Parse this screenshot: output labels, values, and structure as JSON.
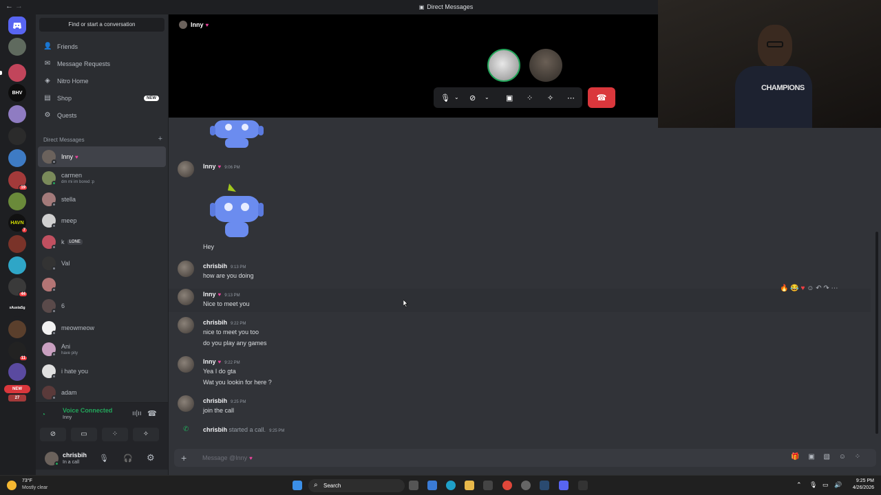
{
  "titlebar": {
    "back": "←",
    "forward": "→",
    "title": "Direct Messages"
  },
  "call": {
    "header_name": "Inny",
    "hangup_icon": "phone-hangup-icon"
  },
  "sidebar": {
    "search_placeholder": "Find or start a conversation",
    "nav": [
      {
        "label": "Friends",
        "icon": "friends-icon"
      },
      {
        "label": "Message Requests",
        "icon": "mail-icon"
      },
      {
        "label": "Nitro Home",
        "icon": "nitro-icon"
      },
      {
        "label": "Shop",
        "icon": "shop-icon",
        "badge": "NEW"
      },
      {
        "label": "Quests",
        "icon": "quests-icon"
      }
    ],
    "dm_header": "Direct Messages",
    "dms": [
      {
        "name": "Inny",
        "sub": ""
      },
      {
        "name": "carmen",
        "sub": "dm mi im bored :p"
      },
      {
        "name": "stella",
        "sub": ""
      },
      {
        "name": "meep",
        "sub": ""
      },
      {
        "name": "k",
        "tag": "LONE",
        "sub": ""
      },
      {
        "name": "Val",
        "sub": ""
      },
      {
        "name": "",
        "sub": ""
      },
      {
        "name": "6",
        "sub": ""
      },
      {
        "name": "meowmeow",
        "sub": ""
      },
      {
        "name": "Ani",
        "sub": "have pity"
      },
      {
        "name": "i hate you",
        "sub": ""
      },
      {
        "name": "adam",
        "sub": ""
      }
    ]
  },
  "servers": {
    "badges": [
      "19",
      "7",
      "44",
      "11",
      "27"
    ],
    "new_label": "NEW"
  },
  "voice": {
    "status": "Voice Connected",
    "channel": "Inny"
  },
  "user": {
    "name": "chrisbih",
    "status": "In a call"
  },
  "messages": [
    {
      "author": "Inny",
      "time": "9:06 PM",
      "text": "Hey"
    },
    {
      "author": "chrisbih",
      "time": "9:13 PM",
      "text": "how are you doing"
    },
    {
      "author": "Inny",
      "time": "9:13 PM",
      "text": "Nice to meet you"
    },
    {
      "author": "chrisbih",
      "time": "9:22 PM",
      "text": "nice to meet you too",
      "text2": "do you play any games"
    },
    {
      "author": "Inny",
      "time": "9:22 PM",
      "text": "Yea I do gta",
      "text2": "Wat you lookin for here ?"
    },
    {
      "author": "chrisbih",
      "time": "9:25 PM",
      "text": "join the call"
    }
  ],
  "system": {
    "author": "chrisbih",
    "text": "started a call.",
    "time": "9:25 PM"
  },
  "composer": {
    "placeholder": "Message @Inny"
  },
  "camera": {
    "shirt_text": "CHAMPIONS"
  },
  "taskbar": {
    "temp": "73°F",
    "weather": "Mostly clear",
    "search": "Search",
    "time": "9:25 PM",
    "date": "4/26/2026"
  },
  "colors": {
    "accent": "#5865f2",
    "danger": "#da373c",
    "online": "#23a55a"
  }
}
